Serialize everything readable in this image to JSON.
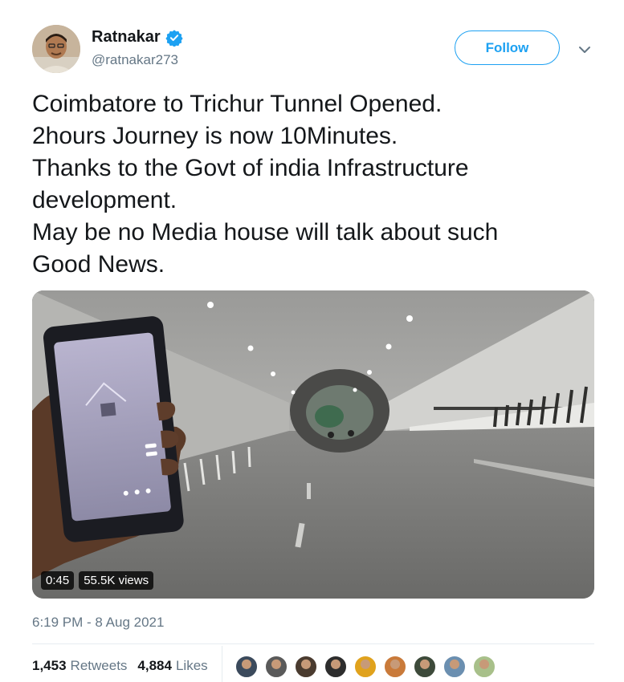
{
  "author": {
    "display_name": "Ratnakar",
    "handle": "@ratnakar273",
    "verified": true,
    "verified_icon": "verified-badge-icon"
  },
  "follow_button": {
    "label": "Follow"
  },
  "menu_icon": "chevron-down-icon",
  "tweet": {
    "lines": [
      "Coimbatore to Trichur Tunnel Opened.",
      "2hours Journey is now 10Minutes.",
      "Thanks to the Govt of india Infrastructure",
      "development.",
      "May be no Media house will talk about such",
      "Good News."
    ]
  },
  "video": {
    "duration": "0:45",
    "views": "55.5K views"
  },
  "timestamp": "6:19 PM - 8 Aug 2021",
  "stats": {
    "retweets_count": "1,453",
    "retweets_label": "Retweets",
    "likes_count": "4,884",
    "likes_label": "Likes"
  },
  "colors": {
    "accent": "#1da1f2",
    "text_primary": "#14171a",
    "text_secondary": "#657786"
  },
  "likers": [
    {
      "color": "#3b4a5c"
    },
    {
      "color": "#5a5a5a"
    },
    {
      "color": "#4a3b2f"
    },
    {
      "color": "#2d2d2d"
    },
    {
      "color": "#e0a21d"
    },
    {
      "color": "#c97a3a"
    },
    {
      "color": "#3d4a3a"
    },
    {
      "color": "#6b8fb0"
    },
    {
      "color": "#a8c08a"
    }
  ]
}
